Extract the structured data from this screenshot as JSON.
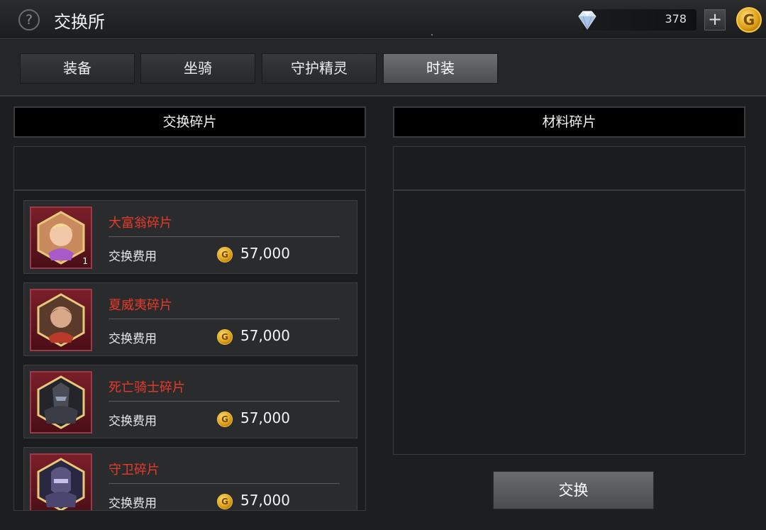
{
  "header": {
    "help_symbol": "?",
    "title": "交换所",
    "diamond_count": "378",
    "plus_symbol": "+",
    "gold_symbol": "G"
  },
  "tabs": [
    {
      "label": "装备",
      "active": false
    },
    {
      "label": "坐骑",
      "active": false
    },
    {
      "label": "守护精灵",
      "active": false
    },
    {
      "label": "时装",
      "active": true
    }
  ],
  "left_panel": {
    "title": "交换碎片",
    "items": [
      {
        "name": "大富翁碎片",
        "cost_label": "交换费用",
        "cost": "57,000",
        "count": "1",
        "portrait_icon": "tycoon-portrait-icon"
      },
      {
        "name": "夏威夷碎片",
        "cost_label": "交换费用",
        "cost": "57,000",
        "count": "",
        "portrait_icon": "hawaii-portrait-icon"
      },
      {
        "name": "死亡骑士碎片",
        "cost_label": "交换费用",
        "cost": "57,000",
        "count": "",
        "portrait_icon": "death-knight-portrait-icon"
      },
      {
        "name": "守卫碎片",
        "cost_label": "交换费用",
        "cost": "57,000",
        "count": "",
        "portrait_icon": "guard-portrait-icon"
      }
    ]
  },
  "right_panel": {
    "title": "材料碎片"
  },
  "exchange_button": "交换",
  "colors": {
    "item_name": "#e83a2a",
    "active_tab": "#5d5e60",
    "gold": "#f7c84a"
  }
}
